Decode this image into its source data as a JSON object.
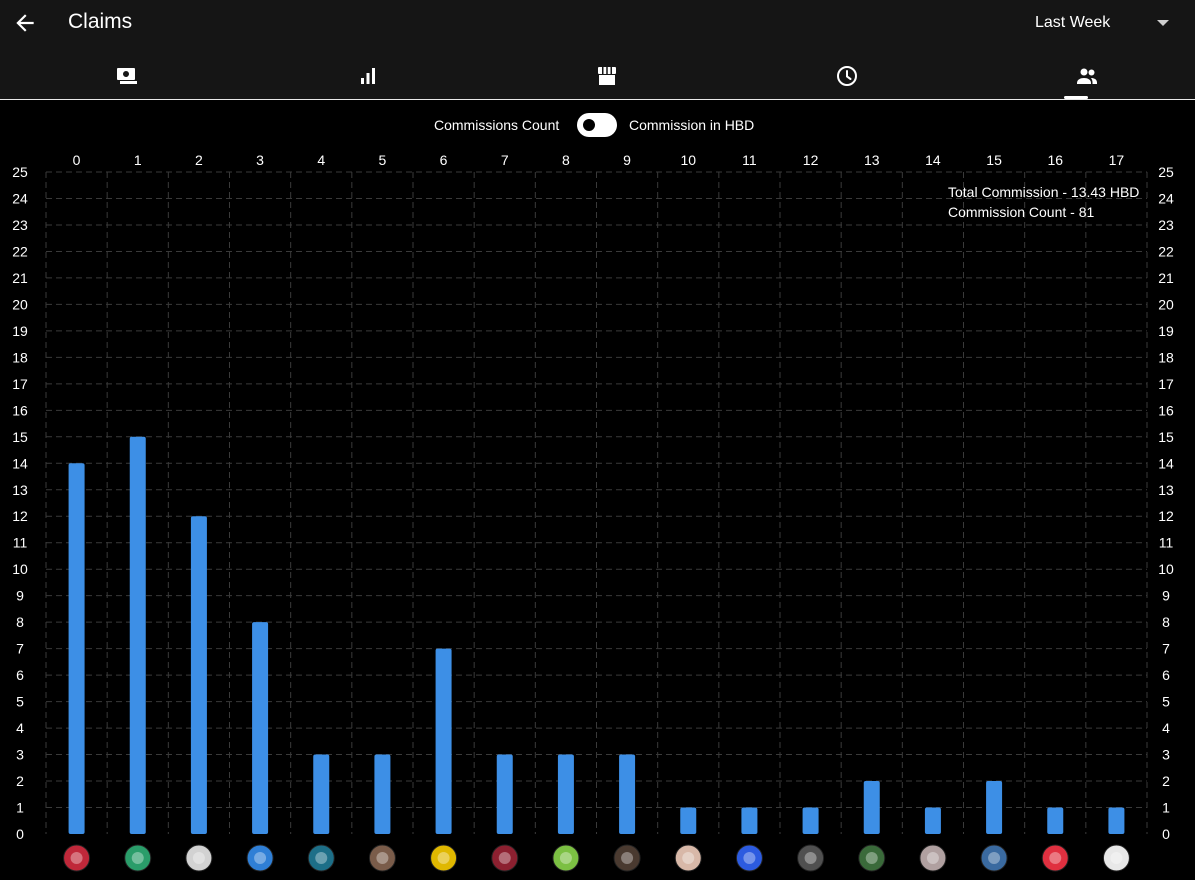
{
  "header": {
    "title": "Claims",
    "period_selected": "Last Week"
  },
  "tabs": [
    {
      "icon": "payments-icon"
    },
    {
      "icon": "bar-chart-icon"
    },
    {
      "icon": "store-icon"
    },
    {
      "icon": "clock-icon"
    },
    {
      "icon": "people-icon",
      "selected": true
    }
  ],
  "toggle": {
    "left_label": "Commissions Count",
    "right_label": "Commission in HBD",
    "state": "left"
  },
  "summary": {
    "total": "Total Commission - 13.43 HBD",
    "count": "Commission Count - 81"
  },
  "colors": {
    "bar": "#3d8fe6",
    "grid": "#3a3a3a",
    "indicator": "#ffffff"
  },
  "chart_data": {
    "type": "bar",
    "categories": [
      "0",
      "1",
      "2",
      "3",
      "4",
      "5",
      "6",
      "7",
      "8",
      "9",
      "10",
      "11",
      "12",
      "13",
      "14",
      "15",
      "16",
      "17"
    ],
    "values": [
      14,
      15,
      12,
      8,
      3,
      3,
      7,
      3,
      3,
      3,
      1,
      1,
      1,
      2,
      1,
      2,
      1,
      1
    ],
    "ylim": [
      0,
      25
    ],
    "yticks": [
      0,
      1,
      2,
      3,
      4,
      5,
      6,
      7,
      8,
      9,
      10,
      11,
      12,
      13,
      14,
      15,
      16,
      17,
      18,
      19,
      20,
      21,
      22,
      23,
      24,
      25
    ],
    "grid": true,
    "y_axis": "both-sides",
    "x_labels_position": "top",
    "category_avatars": [
      "avatar-dcc-logo",
      "avatar-globe-logo",
      "avatar-dcc-logo",
      "avatar-blue-logo",
      "avatar-swirl-logo",
      "avatar-photo",
      "avatar-hive-logo",
      "avatar-photo",
      "avatar-money-bag-logo",
      "avatar-photo",
      "avatar-photo",
      "avatar-blue-logo",
      "avatar-photo",
      "avatar-dotted-logo",
      "avatar-photo",
      "avatar-mountain-logo",
      "avatar-hive-logo",
      "avatar-white-logo"
    ]
  }
}
